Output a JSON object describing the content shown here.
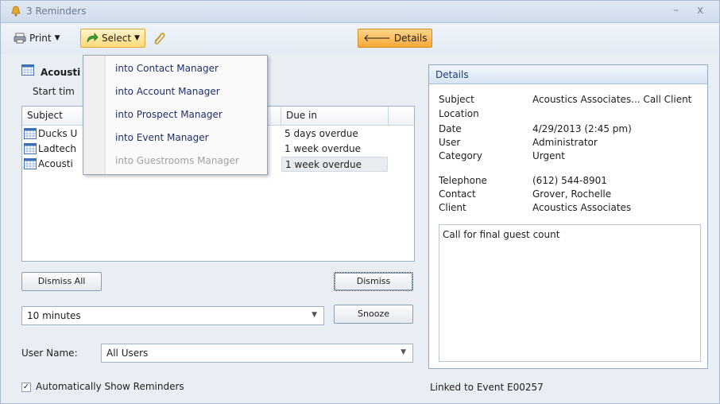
{
  "window": {
    "title": "3 Reminders",
    "minimize": "–",
    "close": "x"
  },
  "toolbar": {
    "print_label": "Print",
    "select_label": "Select",
    "details_label": "Details"
  },
  "select_menu": {
    "items": [
      {
        "label": "into Contact Manager",
        "enabled": true
      },
      {
        "label": "into Account Manager",
        "enabled": true
      },
      {
        "label": "into Prospect Manager",
        "enabled": true
      },
      {
        "label": "into Event Manager",
        "enabled": true
      },
      {
        "label": "into Guestrooms Manager",
        "enabled": false
      }
    ]
  },
  "reminder": {
    "title_visible": "Acousti",
    "start_time_visible": "Start tim"
  },
  "grid": {
    "columns": [
      "Subject",
      "Due in"
    ],
    "rows": [
      {
        "subject": "Ducks U",
        "due": "5 days overdue"
      },
      {
        "subject": "Ladtech",
        "due": "1 week overdue"
      },
      {
        "subject": "Acousti",
        "due": "1 week overdue"
      }
    ]
  },
  "buttons": {
    "dismiss_all": "Dismiss All",
    "dismiss": "Dismiss",
    "snooze": "Snooze"
  },
  "snooze_combo": {
    "value": "10 minutes"
  },
  "user_name": {
    "label": "User Name:",
    "value": "All Users"
  },
  "auto_show": {
    "label": "Automatically Show Reminders",
    "checked": true
  },
  "details": {
    "header": "Details",
    "fields": [
      {
        "key": "Subject",
        "value": "Acoustics Associates... Call Client"
      },
      {
        "key": "Location",
        "value": ""
      },
      {
        "key": "Date",
        "value": "4/29/2013 (2:45 pm)"
      },
      {
        "key": "User",
        "value": "Administrator"
      },
      {
        "key": "Category",
        "value": "Urgent"
      }
    ],
    "contact_fields": [
      {
        "key": "Telephone",
        "value": "(612) 544-8901"
      },
      {
        "key": "Contact",
        "value": "Grover, Rochelle"
      },
      {
        "key": "Client",
        "value": "Acoustics Associates"
      }
    ],
    "notes": "Call for final guest count"
  },
  "linked_to": "Linked to Event E00257",
  "colors": {
    "accent": "#f7a93a",
    "select_highlight": "#ffd979",
    "panel_border": "#8fa8c8"
  }
}
